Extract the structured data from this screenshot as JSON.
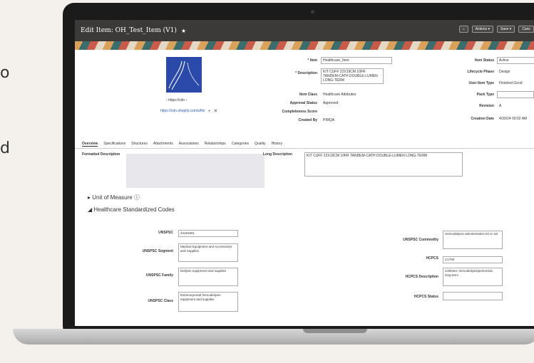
{
  "side_fragments": [
    "o",
    "d"
  ],
  "header": {
    "title": "Edit Item: OH_Test_Item (V1)",
    "star": "★",
    "actions_label": "Actions ▾",
    "save_label": "Save ▾",
    "cancel_label": "Canc"
  },
  "item": {
    "item_label": "* Item",
    "item_value": "Healthcare_Item",
    "description_label": "* Description",
    "description_value": "KIT CUFF 22X19CM 10FR TANDEM-CATH DOUBLE-LUMEN LONG-TERM",
    "item_class_label": "Item Class",
    "item_class_value": "Healthcare Attributes",
    "approval_status_label": "Approval Status",
    "approval_status_value": "Approved",
    "completeness_label": "Completeness Score",
    "created_by_label": "Created By",
    "created_by_value": "PIMQA",
    "pager": "‹   https://cdn   ›",
    "image_url": "https://cdn.shopify.com/s/file"
  },
  "status": {
    "item_status_label": "Item Status",
    "item_status_value": "Active",
    "lifecycle_label": "Lifecycle Phase",
    "lifecycle_value": "Design",
    "user_type_label": "User Item Type",
    "user_type_value": "Finished Good",
    "pack_type_label": "Pack Type",
    "revision_label": "Revision",
    "revision_value": "A",
    "creation_date_label": "Creation Date",
    "creation_date_value": "4/30/24 09:02 AM"
  },
  "tabs": [
    "Overview",
    "Specifications",
    "Structures",
    "Attachments",
    "Associations",
    "Relationships",
    "Categories",
    "Quality",
    "History"
  ],
  "overview": {
    "formatted_desc_label": "Formatted Description",
    "long_desc_label": "Long Description",
    "long_desc_value": "KIT CUFF 22X19CM 10FR TANDEM-CATH DOUBLE-LUMEN LONG-TERM",
    "uom_label": "▸ Unit of Measure ⓘ",
    "hsc_label": "◢ Healthcare Standardized Codes"
  },
  "codes": {
    "unspsc_label": "UNSPSC",
    "unspsc_value": "42181601",
    "segment_label": "UNSPSC Segment",
    "segment_value": "Medical Equipment and Accessories and Supplies",
    "family_label": "UNSPSC Family",
    "family_value": "Dialysis equipment and supplies",
    "class_label": "UNSPSC Class",
    "class_value": "Extracorporeal hemodialysis equipment and supplies",
    "commodity_label": "UNSPSC Commodity",
    "commodity_value": "Hemodialysis administration kit or set",
    "hcpcs_label": "HCPCS",
    "hcpcs_value": "C1750",
    "hcpcs_desc_label": "HCPCS Description",
    "hcpcs_desc_value": "Catheter, hemodialysis/peritoneal, long-term",
    "hcpcs_status_label": "HCPCS Status"
  }
}
